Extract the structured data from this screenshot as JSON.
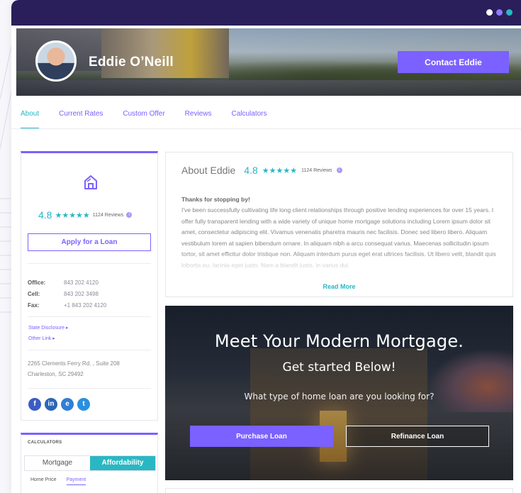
{
  "window": {
    "dot_colors": [
      "#ffffff",
      "#8f7bff",
      "#2ab7c4"
    ]
  },
  "agent": {
    "name": "Eddie O’Neill",
    "contact_label": "Contact Eddie"
  },
  "tabs": [
    {
      "label": "About",
      "active": true
    },
    {
      "label": "Current Rates",
      "active": false
    },
    {
      "label": "Custom Offer",
      "active": false
    },
    {
      "label": "Reviews",
      "active": false
    },
    {
      "label": "Calculators",
      "active": false
    }
  ],
  "sidebar": {
    "icon": "home-icon",
    "rating": "4.8",
    "stars": "★★★★★",
    "review_count": "1124 Reviews",
    "apply_label": "Apply for a Loan",
    "contacts": [
      {
        "label": "Office:",
        "value": "843 202 4120"
      },
      {
        "label": "Cell:",
        "value": "843 202 3498"
      },
      {
        "label": "Fax:",
        "value": "+1 843 202 4120"
      }
    ],
    "links": [
      "State Disclosure ▸",
      "Other Link ▸"
    ],
    "address_line1": "2265 Clements Ferry Rd. , Suite 208",
    "address_line2": "Charleston, SC 29492",
    "socials": [
      {
        "name": "facebook-icon",
        "glyph": "f",
        "color": "#3b5cc4"
      },
      {
        "name": "linkedin-icon",
        "glyph": "in",
        "color": "#2d64b8"
      },
      {
        "name": "email-icon",
        "glyph": "e",
        "color": "#2e7fd6"
      },
      {
        "name": "twitter-icon",
        "glyph": "t",
        "color": "#2a8fe0"
      }
    ]
  },
  "calculators": {
    "title": "CALCULATORS",
    "options": [
      "Mortgage",
      "Affordability"
    ],
    "selected": "Affordability",
    "subtabs": [
      "Home Price",
      "Payment"
    ],
    "selected_subtab": "Payment"
  },
  "about": {
    "title": "About Eddie",
    "rating": "4.8",
    "stars": "★★★★★",
    "review_count": "1124 Reviews",
    "greeting": "Thanks for stopping by!",
    "body": "I've been successfully cultivating life long client relationships through positive lending experiences for over 15 years. I offer fully transparent lending with a wide variety of unique home mortgage solutions including  Lorem ipsum dolor sit amet, consectetur adipiscing elit. Vivamus venenatis pharetra mauris nec facilisis. Donec sed libero libero. Aliquam vestibulum lorem at sapien bibendum ornare. In aliquam nibh a arcu consequat varius. Maecenas sollicitudin ipsum tortor, sit amet efficitur dolor tristique non. Aliquam interdum purus eget erat ultrices facilisis. Ut libero velit, blandit quis lobortis eu, lacinia eget justo. Nam a blandit justo, in varius dui.",
    "read_more": "Read More"
  },
  "mortgage": {
    "title": "Meet Your Modern Mortgage.",
    "subtitle": "Get started Below!",
    "question": "What type of home loan are you looking for?",
    "purchase_label": "Purchase Loan",
    "refinance_label": "Refinance Loan"
  },
  "colors": {
    "accent": "#7b61ff",
    "teal": "#2ab7c4",
    "header": "#2a1f5a"
  }
}
